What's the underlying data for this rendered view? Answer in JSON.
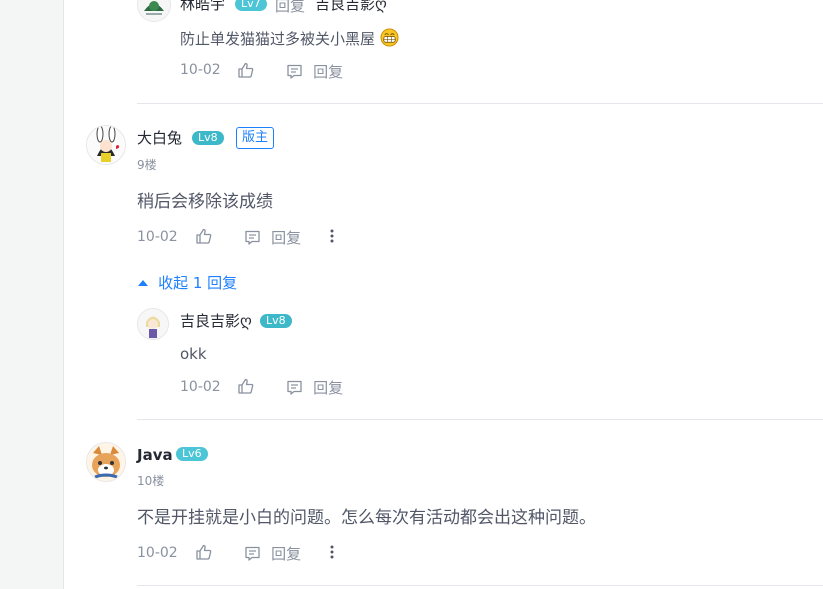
{
  "colors": {
    "accent": "#1e80ff",
    "level_badge": "#4cc5d6",
    "level_badge_lv8": "#3cb8c8",
    "meta_text": "#8a919f"
  },
  "top_reply": {
    "user": "林皓宇",
    "level": "Lv7",
    "reply_word": "回复",
    "target_user": "吉良吉影ღ",
    "content": "防止单发猫猫过多被关小黑屋",
    "emoji": "grin-emoji",
    "date": "10-02",
    "reply_label": "回复"
  },
  "comments": [
    {
      "user": "大白兔",
      "level": "Lv8",
      "mod_badge": "版主",
      "floor": "9楼",
      "content": "稍后会移除该成绩",
      "date": "10-02",
      "reply_label": "回复",
      "collapse_label": "收起 1 回复",
      "replies": [
        {
          "user": "吉良吉影ღ",
          "level": "Lv8",
          "content": "okk",
          "date": "10-02",
          "reply_label": "回复"
        }
      ]
    },
    {
      "user": "Java",
      "level": "Lv6",
      "floor": "10楼",
      "content": "不是开挂就是小白的问题。怎么每次有活动都会出这种问题。",
      "date": "10-02",
      "reply_label": "回复"
    }
  ],
  "icons": {
    "like": "thumbs-up-icon",
    "reply": "comment-icon",
    "more": "more-vertical-icon",
    "collapse": "caret-up-icon"
  }
}
